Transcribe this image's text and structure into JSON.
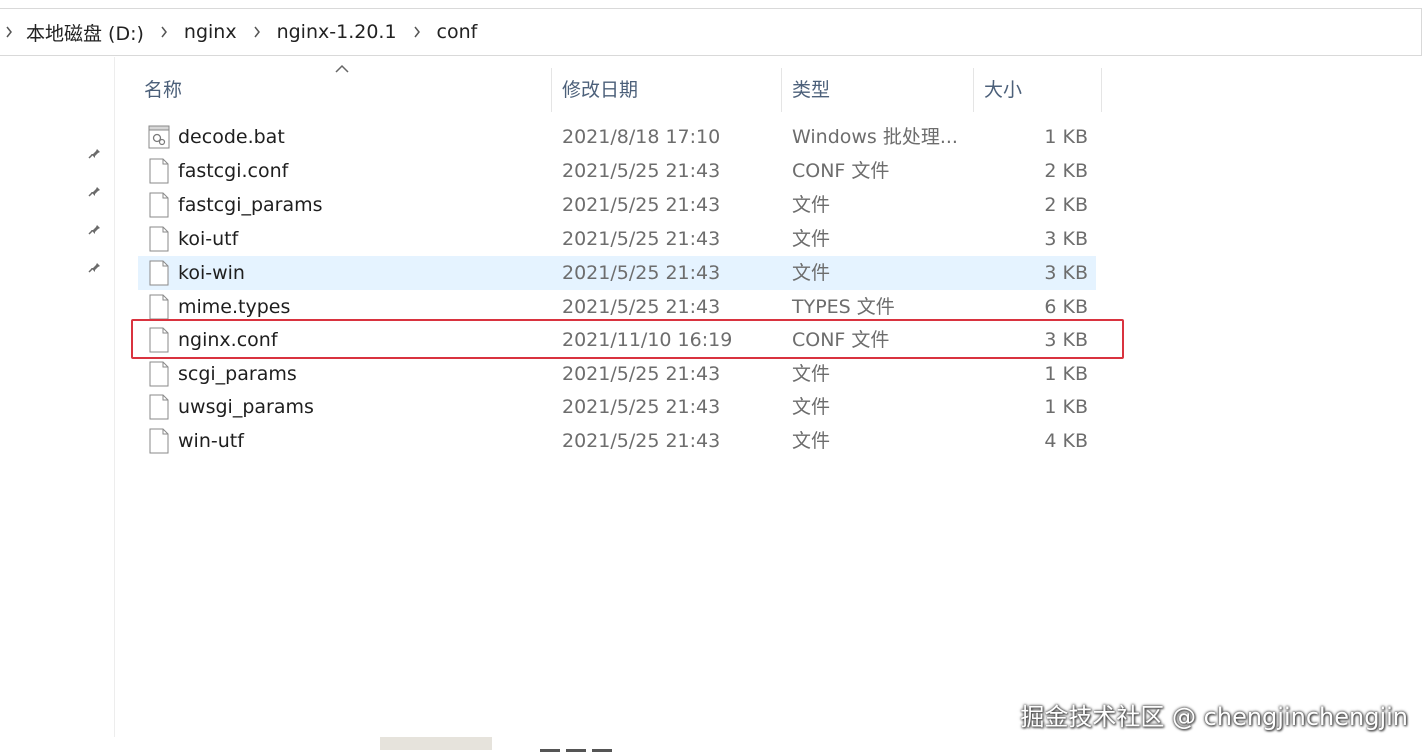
{
  "breadcrumb": {
    "items": [
      "本地磁盘 (D:)",
      "nginx",
      "nginx-1.20.1",
      "conf"
    ]
  },
  "columns": {
    "name": "名称",
    "date": "修改日期",
    "type": "类型",
    "size": "大小"
  },
  "files": [
    {
      "name": "decode.bat",
      "date": "2021/8/18 17:10",
      "type": "Windows 批处理...",
      "size": "1 KB",
      "icon": "batch-file-icon"
    },
    {
      "name": "fastcgi.conf",
      "date": "2021/5/25 21:43",
      "type": "CONF 文件",
      "size": "2 KB",
      "icon": "file-icon"
    },
    {
      "name": "fastcgi_params",
      "date": "2021/5/25 21:43",
      "type": "文件",
      "size": "2 KB",
      "icon": "file-icon"
    },
    {
      "name": "koi-utf",
      "date": "2021/5/25 21:43",
      "type": "文件",
      "size": "3 KB",
      "icon": "file-icon"
    },
    {
      "name": "koi-win",
      "date": "2021/5/25 21:43",
      "type": "文件",
      "size": "3 KB",
      "icon": "file-icon",
      "hovered": true
    },
    {
      "name": "mime.types",
      "date": "2021/5/25 21:43",
      "type": "TYPES 文件",
      "size": "6 KB",
      "icon": "file-icon"
    },
    {
      "name": "nginx.conf",
      "date": "2021/11/10 16:19",
      "type": "CONF 文件",
      "size": "3 KB",
      "icon": "file-icon",
      "highlighted": true
    },
    {
      "name": "scgi_params",
      "date": "2021/5/25 21:43",
      "type": "文件",
      "size": "1 KB",
      "icon": "file-icon"
    },
    {
      "name": "uwsgi_params",
      "date": "2021/5/25 21:43",
      "type": "文件",
      "size": "1 KB",
      "icon": "file-icon"
    },
    {
      "name": "win-utf",
      "date": "2021/5/25 21:43",
      "type": "文件",
      "size": "4 KB",
      "icon": "file-icon"
    }
  ],
  "colors": {
    "hover_row": "#e5f3ff",
    "highlight_border": "#d9333f",
    "header_text": "#4c607a"
  },
  "watermark": "掘金技术社区 @ chengjinchengjin"
}
